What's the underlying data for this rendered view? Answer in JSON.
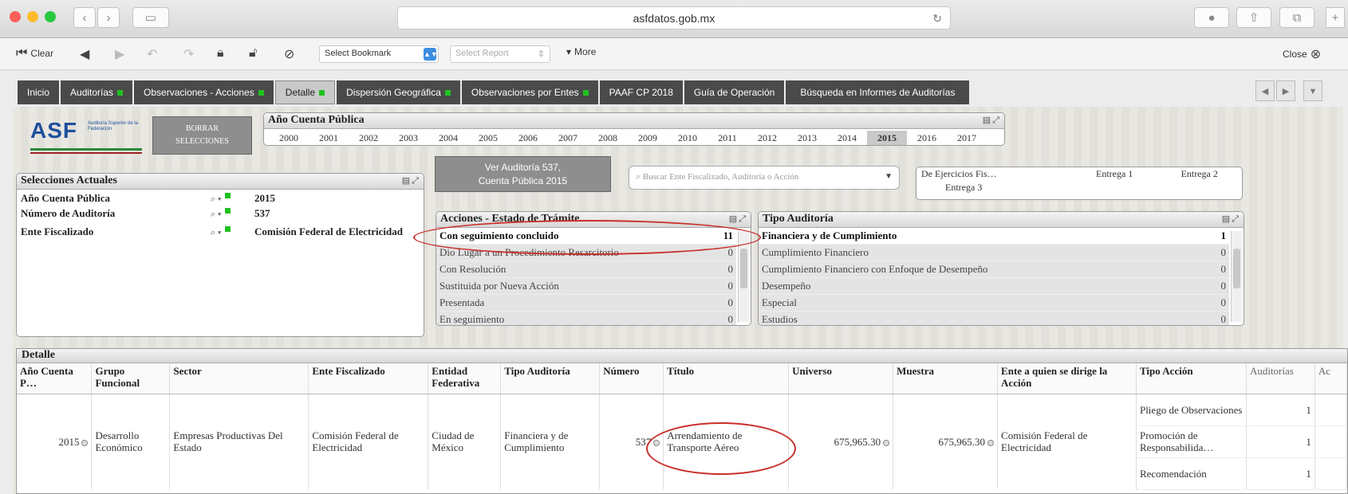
{
  "browser": {
    "url": "asfdatos.gob.mx"
  },
  "toolbar": {
    "clear": "Clear",
    "bookmark_select": "Select Bookmark",
    "report_select": "Select Report",
    "more": "More",
    "close": "Close"
  },
  "tabs": [
    {
      "label": "Inicio"
    },
    {
      "label": "Auditorías"
    },
    {
      "label": "Observaciones - Acciones"
    },
    {
      "label": "Detalle"
    },
    {
      "label": "Dispersión Geográfica"
    },
    {
      "label": "Observaciones por Entes"
    },
    {
      "label": "PAAF CP 2018"
    },
    {
      "label": "Guía de Operación"
    },
    {
      "label": "Búsqueda en Informes de Auditorías"
    }
  ],
  "logo": {
    "text": "ASF",
    "subtitle": "Auditoría Superior de la Federación"
  },
  "borrar_btn": {
    "line1": "BORRAR",
    "line2": "SELECCIONES"
  },
  "years_panel": {
    "title": "Año Cuenta Pública",
    "years": [
      "2000",
      "2001",
      "2002",
      "2003",
      "2004",
      "2005",
      "2006",
      "2007",
      "2008",
      "2009",
      "2010",
      "2011",
      "2012",
      "2013",
      "2014",
      "2015",
      "2016",
      "2017"
    ],
    "selected": "2015"
  },
  "selections": {
    "title": "Selecciones Actuales",
    "rows": [
      {
        "label": "Año Cuenta Pública",
        "value": "2015"
      },
      {
        "label": "Número de Auditoría",
        "value": "537"
      },
      {
        "label": "Ente Fiscalizado",
        "value": "Comisión Federal de Electricidad"
      }
    ]
  },
  "ver_btn": {
    "line1": "Ver Auditoría 537,",
    "line2": "Cuenta Pública 2015"
  },
  "search": {
    "placeholder": "Buscar Ente Fiscalizado, Auditoría o Acción"
  },
  "delivery": {
    "c1": "De Ejercicios Fis…",
    "c2": "Entrega 1",
    "c3": "Entrega 2",
    "c4": "Entrega 3"
  },
  "acciones": {
    "title": "Acciones - Estado de Trámite",
    "items": [
      {
        "label": "Con seguimiento concluido",
        "count": "11"
      },
      {
        "label": "Dio Lugar a un Procedimiento Resarcitorio",
        "count": "0"
      },
      {
        "label": "Con Resolución",
        "count": "0"
      },
      {
        "label": "Sustituida por Nueva Acción",
        "count": "0"
      },
      {
        "label": "Presentada",
        "count": "0"
      },
      {
        "label": "En seguimiento",
        "count": "0"
      }
    ]
  },
  "tipo": {
    "title": "Tipo Auditoría",
    "items": [
      {
        "label": "Financiera y de Cumplimiento",
        "count": "1"
      },
      {
        "label": "Cumplimiento Financiero",
        "count": "0"
      },
      {
        "label": "Cumplimiento Financiero con Enfoque de Desempeño",
        "count": "0"
      },
      {
        "label": "Desempeño",
        "count": "0"
      },
      {
        "label": "Especial",
        "count": "0"
      },
      {
        "label": "Estudios",
        "count": "0"
      }
    ]
  },
  "detail": {
    "title": "Detalle",
    "headers": [
      "Año Cuenta P…",
      "Grupo Funcional",
      "Sector",
      "Ente Fiscalizado",
      "Entidad Federativa",
      "Tipo Auditoría",
      "Número",
      "Título",
      "Universo",
      "Muestra",
      "Ente a quien se dirige la Acción",
      "Tipo Acción",
      "Auditorías",
      "Ac"
    ],
    "row": {
      "anio": "2015",
      "grupo": "Desarrollo Económico",
      "sector": "Empresas Productivas Del Estado",
      "ente": "Comisión Federal de Electricidad",
      "entidad": "Ciudad de México",
      "tipo": "Financiera y de Cumplimiento",
      "numero": "537",
      "titulo": "Arrendamiento de Transporte Aéreo",
      "universo": "675,965.30",
      "muestra": "675,965.30",
      "dirige": "Comisión Federal de Electricidad",
      "acciones": [
        {
          "tipo": "Pliego de Observaciones",
          "aud": "1"
        },
        {
          "tipo": "Promoción de Responsabilida…",
          "aud": "1"
        },
        {
          "tipo": "Recomendación",
          "aud": "1"
        }
      ]
    }
  },
  "colors": {
    "accent_green": "#22c020",
    "tab_dark": "#4a4a4a",
    "circle_red": "#c9302c"
  }
}
